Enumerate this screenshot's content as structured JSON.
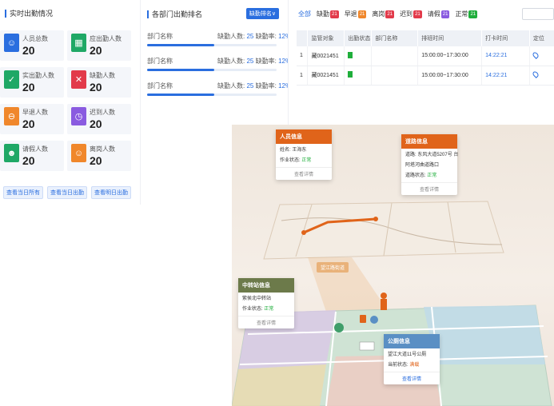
{
  "left_panel": {
    "title": "实时出勤情况",
    "stats": [
      {
        "label": "人员总数",
        "value": "20",
        "color": "#2a6edf",
        "icon": "person-icon"
      },
      {
        "label": "应出勤人数",
        "value": "20",
        "color": "#1fa866",
        "icon": "calendar-icon"
      },
      {
        "label": "实出勤人数",
        "value": "20",
        "color": "#1fa866",
        "icon": "check-calendar-icon"
      },
      {
        "label": "缺勤人数",
        "value": "20",
        "color": "#e23a4a",
        "icon": "x-calendar-icon"
      },
      {
        "label": "早退人数",
        "value": "20",
        "color": "#f0872b",
        "icon": "minus-circle-icon"
      },
      {
        "label": "迟到人数",
        "value": "20",
        "color": "#8a5be0",
        "icon": "clock-icon"
      },
      {
        "label": "请假人数",
        "value": "20",
        "color": "#1fa866",
        "icon": "person-leave-icon"
      },
      {
        "label": "离岗人数",
        "value": "20",
        "color": "#f0872b",
        "icon": "person-away-icon"
      }
    ],
    "links": [
      "查看当日所有",
      "查看当日出勤",
      "查看明日出勤"
    ]
  },
  "mid_panel": {
    "title": "各部门出勤排名",
    "sort_label": "缺勤排名∨",
    "rows": [
      {
        "name": "部门名称",
        "lack_label": "缺勤人数:",
        "lack": "25",
        "rate_label": "缺勤率:",
        "rate": "12%",
        "progress": 0.52
      },
      {
        "name": "部门名称",
        "lack_label": "缺勤人数:",
        "lack": "25",
        "rate_label": "缺勤率:",
        "rate": "12%",
        "progress": 0.52
      },
      {
        "name": "部门名称",
        "lack_label": "缺勤人数:",
        "lack": "25",
        "rate_label": "缺勤率:",
        "rate": "12%",
        "progress": 0.52
      }
    ]
  },
  "right_panel": {
    "filters": [
      {
        "label": "全部",
        "badge": "",
        "color": ""
      },
      {
        "label": "缺勤",
        "badge": "21",
        "color": "#e23a4a"
      },
      {
        "label": "早退",
        "badge": "21",
        "color": "#f0872b"
      },
      {
        "label": "离岗",
        "badge": "21",
        "color": "#e23a4a"
      },
      {
        "label": "迟到",
        "badge": "21",
        "color": "#e23a4a"
      },
      {
        "label": "请假",
        "badge": "21",
        "color": "#8a5be0"
      },
      {
        "label": "正常",
        "badge": "21",
        "color": "#1fae3b"
      }
    ],
    "columns": [
      "",
      "监管对象",
      "出勤状态",
      "部门名称",
      "排班时间",
      "打卡时间",
      "定位"
    ],
    "rows": [
      {
        "idx": "1",
        "obj": "藏0021451",
        "status": "ok",
        "dept": "",
        "shift": "15:00:00~17:30:00",
        "punch": "14:22:21"
      },
      {
        "idx": "1",
        "obj": "藏0021451",
        "status": "ok",
        "dept": "",
        "shift": "15:00:00~17:30:00",
        "punch": "14:22:21"
      }
    ]
  },
  "illustration": {
    "cards": {
      "person": {
        "title": "人员信息",
        "name_label": "姓名:",
        "name": "王海东",
        "status_label": "作业状态:",
        "status": "正常",
        "footer": "查看详情",
        "color": "#e0641a"
      },
      "road": {
        "title": "道路信息",
        "line1_label": "道路:",
        "line1": "东风大道5207号",
        "line1_suffix": "台",
        "line2": "阿塔河曲道路口",
        "status_label": "道路状态:",
        "status": "正常",
        "footer": "查看详情",
        "color": "#e0641a"
      },
      "transfer": {
        "title": "中转站信息",
        "line1": "紫侯北中转站",
        "status_label": "作业状态:",
        "status": "正常",
        "footer": "查看详情",
        "color": "#6c7a4a"
      },
      "toilet": {
        "title": "公厕信息",
        "line1": "望江大道11号公厕",
        "status_label": "当前状态:",
        "status": "满载",
        "footer": "查看详情",
        "color": "#5a8fc4"
      }
    },
    "zone_label": "望江路街道"
  }
}
